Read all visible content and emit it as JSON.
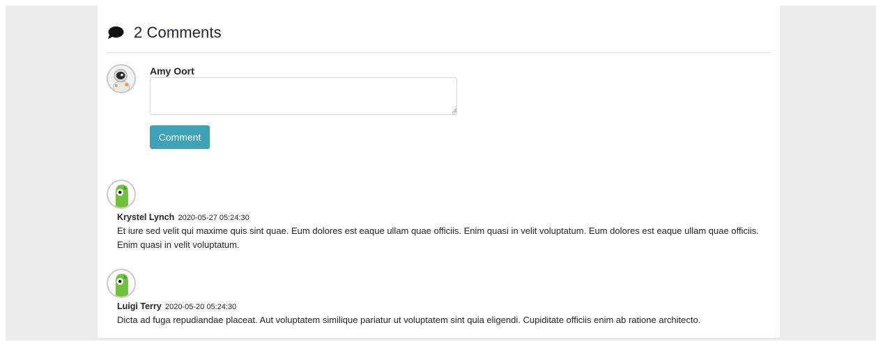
{
  "comments_section": {
    "heading": "2 Comments"
  },
  "composer": {
    "user_name": "Amy Oort",
    "textarea_value": "",
    "submit_label": "Comment"
  },
  "comments": [
    {
      "author": "Krystel Lynch",
      "timestamp": "2020-05-27 05:24:30",
      "text": "Et iure sed velit qui maxime quis sint quae. Eum dolores est eaque ullam quae officiis. Enim quasi in velit voluptatum. Eum dolores est eaque ullam quae officiis. Enim quasi in velit voluptatum."
    },
    {
      "author": "Luigi Terry",
      "timestamp": "2020-05-20 05:24:30",
      "text": "Dicta ad fuga repudiandae placeat. Aut voluptatem similique pariatur ut voluptatem sint quia eligendi. Cupiditate officiis enim ab ratione architecto."
    }
  ],
  "colors": {
    "accent_button": "#3fa2b4",
    "page_background": "#ebebeb",
    "card_background": "#ffffff"
  }
}
